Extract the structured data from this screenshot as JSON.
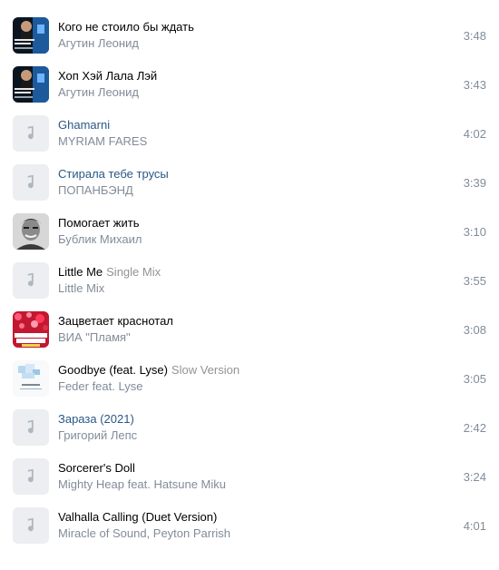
{
  "tracks": [
    {
      "title": "Кого не стоило бы ждать",
      "subtitle": "",
      "artist": "Агутин Леонид",
      "duration": "3:48",
      "cover": "agutin-cover",
      "link": false
    },
    {
      "title": "Хоп Хэй Лала Лэй",
      "subtitle": "",
      "artist": "Агутин Леонид",
      "duration": "3:43",
      "cover": "agutin-cover",
      "link": false
    },
    {
      "title": "Ghamarni",
      "subtitle": "",
      "artist": "MYRIAM FARES",
      "duration": "4:02",
      "cover": "music-note-icon",
      "link": true
    },
    {
      "title": "Стирала тебе трусы",
      "subtitle": "",
      "artist": "ПОПАНБЭНД",
      "duration": "3:39",
      "cover": "music-note-icon",
      "link": true
    },
    {
      "title": "Помогает жить",
      "subtitle": "",
      "artist": "Бублик Михаил",
      "duration": "3:10",
      "cover": "bublik-cover",
      "link": false
    },
    {
      "title": "Little Me",
      "subtitle": "Single Mix",
      "artist": "Little Mix",
      "duration": "3:55",
      "cover": "music-note-icon",
      "link": false
    },
    {
      "title": "Зацветает краснотал",
      "subtitle": "",
      "artist": "ВИА \"Пламя\"",
      "duration": "3:08",
      "cover": "plamya-cover",
      "link": false
    },
    {
      "title": "Goodbye (feat. Lyse)",
      "subtitle": "Slow Version",
      "artist": "Feder feat. Lyse",
      "duration": "3:05",
      "cover": "feder-cover",
      "link": false
    },
    {
      "title": "Зараза (2021)",
      "subtitle": "",
      "artist": "Григорий Лепс",
      "duration": "2:42",
      "cover": "music-note-icon",
      "link": true
    },
    {
      "title": "Sorcerer's Doll",
      "subtitle": "",
      "artist": "Mighty Heap feat. Hatsune Miku",
      "duration": "3:24",
      "cover": "music-note-icon",
      "link": false
    },
    {
      "title": "Valhalla Calling (Duet Version)",
      "subtitle": "",
      "artist": "Miracle of Sound, Peyton Parrish",
      "duration": "4:01",
      "cover": "music-note-icon",
      "link": false
    }
  ]
}
